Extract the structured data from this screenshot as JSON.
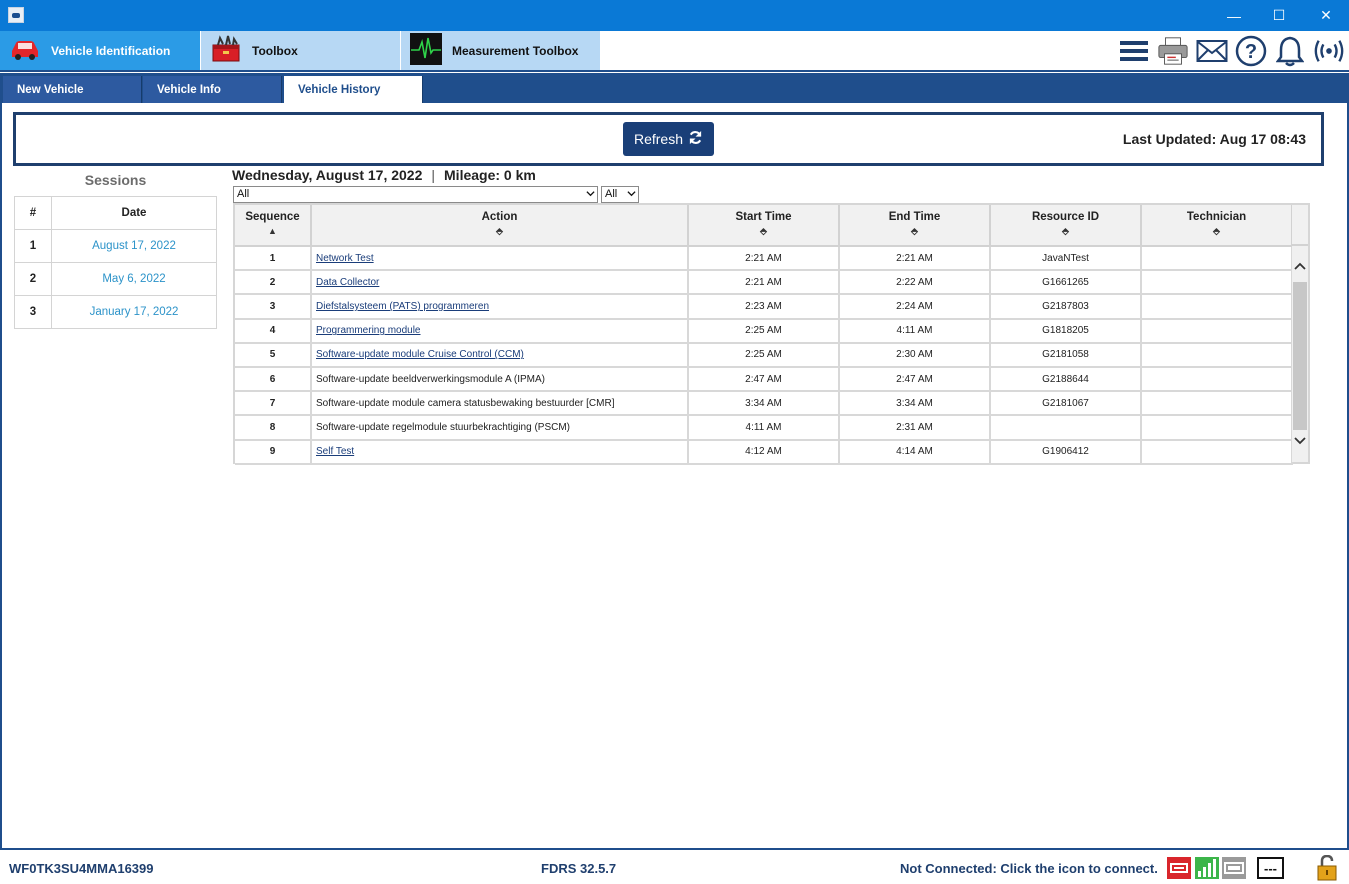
{
  "window": {
    "minimize": "—",
    "maximize": "☐",
    "close": "✕"
  },
  "main_tabs": [
    {
      "label": "Vehicle Identification"
    },
    {
      "label": "Toolbox"
    },
    {
      "label": "Measurement Toolbox"
    }
  ],
  "sub_tabs": [
    {
      "label": "New Vehicle"
    },
    {
      "label": "Vehicle Info"
    },
    {
      "label": "Vehicle History"
    }
  ],
  "refresh": {
    "label": "Refresh",
    "last_updated": "Last Updated: Aug 17 08:43"
  },
  "sessions": {
    "title": "Sessions",
    "headers": [
      "#",
      "Date"
    ],
    "rows": [
      {
        "num": "1",
        "date": "August 17, 2022"
      },
      {
        "num": "2",
        "date": "May 6, 2022"
      },
      {
        "num": "3",
        "date": "January 17, 2022"
      }
    ]
  },
  "details": {
    "date": "Wednesday, August 17, 2022",
    "separator": "|",
    "mileage": "Mileage: 0 km",
    "filter1": "All",
    "filter2": "All"
  },
  "actions": {
    "headers": [
      "Sequence",
      "Action",
      "Start Time",
      "End Time",
      "Resource ID",
      "Technician"
    ],
    "rows": [
      {
        "seq": "1",
        "action": "Network Test",
        "start": "2:21 AM",
        "end": "2:21 AM",
        "resource": "JavaNTest",
        "tech": ""
      },
      {
        "seq": "2",
        "action": "Data Collector",
        "start": "2:21 AM",
        "end": "2:22 AM",
        "resource": "G1661265",
        "tech": ""
      },
      {
        "seq": "3",
        "action": "Diefstalsysteem (PATS) programmeren",
        "start": "2:23 AM",
        "end": "2:24 AM",
        "resource": "G2187803",
        "tech": ""
      },
      {
        "seq": "4",
        "action": "Programmering module",
        "start": "2:25 AM",
        "end": "4:11 AM",
        "resource": "G1818205",
        "tech": ""
      },
      {
        "seq": "5",
        "action": "Software-update module Cruise Control (CCM)",
        "start": "2:25 AM",
        "end": "2:30 AM",
        "resource": "G2181058",
        "tech": ""
      },
      {
        "seq": "6",
        "action": "Software-update beeldverwerkingsmodule A (IPMA)",
        "start": "2:47 AM",
        "end": "2:47 AM",
        "resource": "G2188644",
        "tech": ""
      },
      {
        "seq": "7",
        "action": "Software-update module camera statusbewaking bestuurder [CMR]",
        "start": "3:34 AM",
        "end": "3:34 AM",
        "resource": "G2181067",
        "tech": ""
      },
      {
        "seq": "8",
        "action": "Software-update regelmodule stuurbekrachtiging (PSCM)",
        "start": "4:11 AM",
        "end": "2:31 AM",
        "resource": "",
        "tech": ""
      },
      {
        "seq": "9",
        "action": "Self Test",
        "start": "4:12 AM",
        "end": "4:14 AM",
        "resource": "G1906412",
        "tech": ""
      }
    ]
  },
  "status": {
    "vin": "WF0TK3SU4MMA16399",
    "version": "FDRS 32.5.7",
    "connection": "Not Connected: Click the icon to connect.",
    "dashes": "---"
  },
  "colors": {
    "accent": "#1f4e8c",
    "tab_active": "#2b9be6",
    "tab_inactive": "#b7d8f4",
    "link": "#2c93c9"
  }
}
